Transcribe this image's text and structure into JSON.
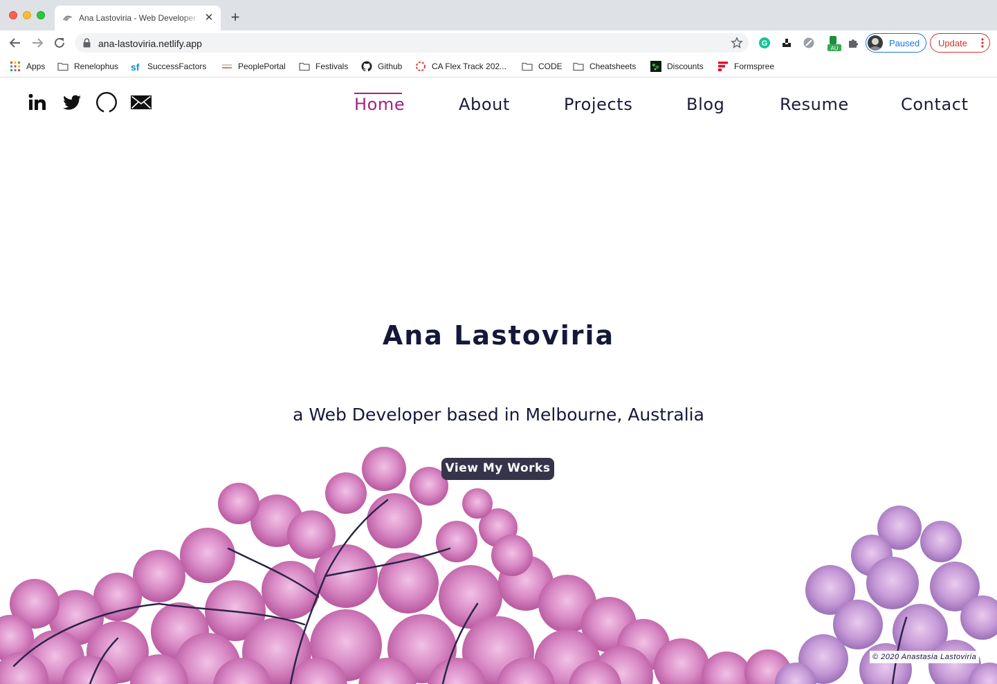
{
  "browser": {
    "tab": {
      "title": "Ana Lastoviria - Web Developer"
    },
    "url": "ana-lastoviria.netlify.app",
    "profile": {
      "status": "Paused"
    },
    "update_label": "Update",
    "bookmarks": [
      {
        "label": "Apps",
        "icon": "apps-grid-icon"
      },
      {
        "label": "Renelophus",
        "icon": "folder-icon"
      },
      {
        "label": "SuccessFactors",
        "icon": "successfactors-icon"
      },
      {
        "label": "PeoplePortal",
        "icon": "peopleportal-icon"
      },
      {
        "label": "Festivals",
        "icon": "folder-icon"
      },
      {
        "label": "Github",
        "icon": "github-icon"
      },
      {
        "label": "CA Flex Track 202...",
        "icon": "ca-flex-icon"
      },
      {
        "label": "CODE",
        "icon": "folder-icon"
      },
      {
        "label": "Cheatsheets",
        "icon": "folder-icon"
      },
      {
        "label": "Discounts",
        "icon": "discounts-icon"
      },
      {
        "label": "Formspree",
        "icon": "formspree-icon"
      }
    ]
  },
  "site": {
    "social": [
      "linkedin-icon",
      "twitter-icon",
      "github-icon",
      "email-icon"
    ],
    "nav": {
      "home": "Home",
      "about": "About",
      "projects": "Projects",
      "blog": "Blog",
      "resume": "Resume",
      "contact": "Contact"
    },
    "active_nav": "Home",
    "hero": {
      "name": "Ana Lastoviria",
      "tagline": "a Web Developer based in Melbourne, Australia",
      "button": "View My Works"
    },
    "copyright": "© 2020 Anastasia Lastoviria"
  },
  "colors": {
    "accent": "#a4237d",
    "text": "#16183a",
    "button": "#35344a",
    "blossom": "#d98bc6"
  }
}
